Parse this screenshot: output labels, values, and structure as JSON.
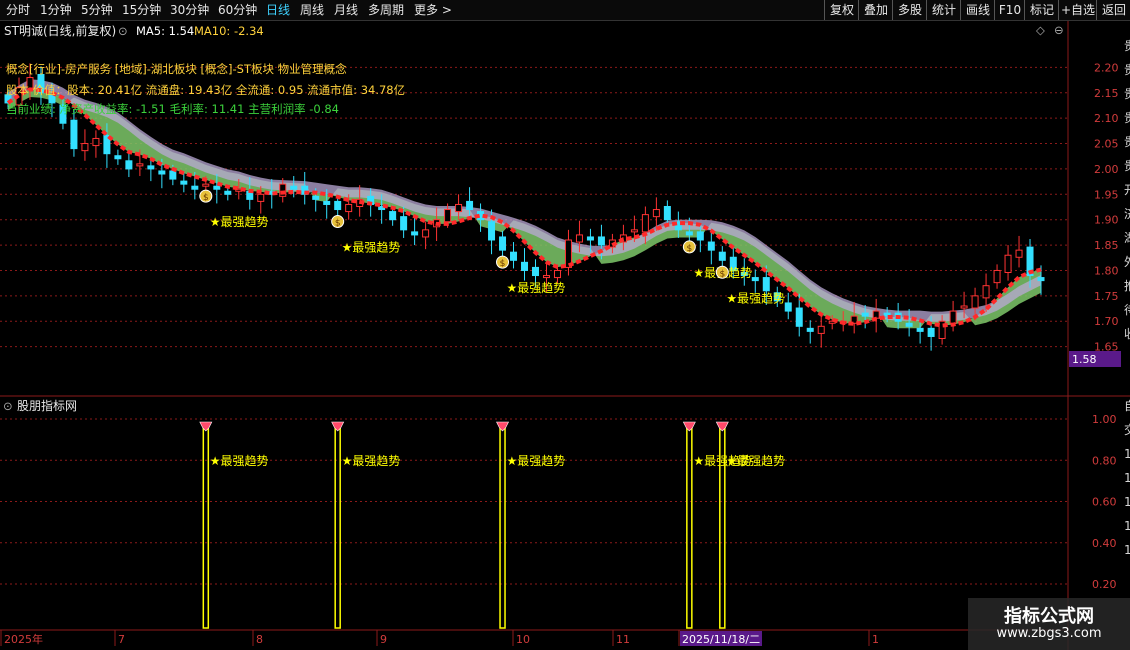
{
  "toolbar": {
    "left_tabs": [
      "分时",
      "1分钟",
      "5分钟",
      "15分钟",
      "30分钟",
      "60分钟",
      "日线",
      "周线",
      "月线",
      "多周期",
      "更多 >"
    ],
    "active_tab": "日线",
    "right_buttons": [
      "复权",
      "叠加",
      "多股",
      "统计",
      "画线",
      "F10",
      "标记",
      "+自选",
      "返回"
    ]
  },
  "header": {
    "stock_name": "ST明诚(日线,前复权)",
    "ma5_label": "MA5: 1.54",
    "ma10_label": "MA10: -2.34"
  },
  "info": {
    "line1": "概念[行业]-房产服务 [地域]-湖北板块 [概念]-ST板块 物业管理概念",
    "line2": "股本 价值：股本: 20.41亿 流通盘: 19.43亿 全流通: 0.95 流通市值: 34.78亿",
    "line3": "当前业绩: 净资产收益率: -1.51 毛利率: 11.41 主营利润率 -0.84"
  },
  "signal_label": "★最强趋势",
  "main_axis": {
    "ticks": [
      "2.20",
      "2.15",
      "2.10",
      "2.05",
      "2.00",
      "1.95",
      "1.90",
      "1.85",
      "1.80",
      "1.75",
      "1.70",
      "1.65"
    ],
    "current_price": "1.58"
  },
  "indicator": {
    "title": "股朋指标网",
    "ticks": [
      "1.00",
      "0.80",
      "0.60",
      "0.40",
      "0.20"
    ]
  },
  "date_axis": {
    "labels": [
      "2025年",
      "7",
      "8",
      "9",
      "10",
      "11",
      "2025/11/18/二",
      "1"
    ]
  },
  "right_panel_chars": [
    "贵",
    "贵",
    "贵",
    "贵",
    "贵",
    "贵",
    "开",
    "济",
    "湖",
    "外",
    "推",
    "待",
    "收"
  ],
  "right_panel_lower": [
    "自",
    "交",
    "1",
    "1",
    "1",
    "1",
    "1"
  ],
  "watermark": {
    "title": "指标公式网",
    "url": "www.zbgs3.com"
  },
  "colors": {
    "up": "#ff3333",
    "down": "#33e0ff",
    "signal": "#ffff00",
    "grid": "#8b1a1a",
    "ribbon_green": "#7ec86a",
    "ribbon_purple": "#b9a8d6",
    "ribbon_yellow": "#d4c92a"
  },
  "chart_data": {
    "type": "candlestick",
    "ylim": [
      1.6,
      2.25
    ],
    "closes": [
      2.13,
      2.16,
      2.18,
      2.15,
      2.13,
      2.09,
      2.04,
      2.05,
      2.06,
      2.03,
      2.02,
      2.0,
      2.01,
      2.0,
      1.99,
      1.98,
      1.97,
      1.96,
      1.97,
      1.96,
      1.95,
      1.96,
      1.94,
      1.95,
      1.95,
      1.97,
      1.96,
      1.95,
      1.94,
      1.93,
      1.92,
      1.93,
      1.94,
      1.93,
      1.92,
      1.9,
      1.88,
      1.87,
      1.88,
      1.9,
      1.92,
      1.93,
      1.92,
      1.9,
      1.86,
      1.84,
      1.82,
      1.8,
      1.79,
      1.79,
      1.8,
      1.86,
      1.87,
      1.86,
      1.85,
      1.86,
      1.87,
      1.88,
      1.91,
      1.92,
      1.9,
      1.88,
      1.87,
      1.86,
      1.84,
      1.82,
      1.8,
      1.79,
      1.78,
      1.76,
      1.74,
      1.72,
      1.69,
      1.68,
      1.69,
      1.7,
      1.7,
      1.71,
      1.71,
      1.72,
      1.71,
      1.7,
      1.69,
      1.68,
      1.67,
      1.7,
      1.72,
      1.73,
      1.75,
      1.77,
      1.8,
      1.83,
      1.84,
      1.79,
      1.78
    ],
    "signal_indices": [
      18,
      30,
      45,
      62,
      65
    ],
    "indicator_signal_indices": [
      18,
      30,
      45,
      62,
      65
    ]
  }
}
